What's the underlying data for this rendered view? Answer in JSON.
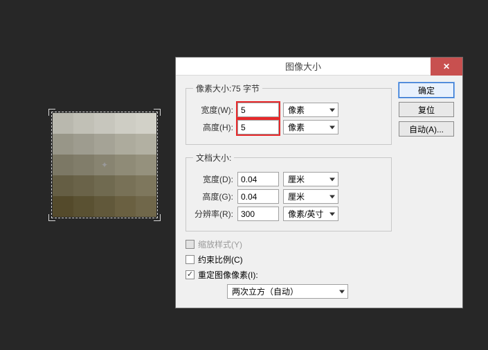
{
  "dialog": {
    "title": "图像大小",
    "close_icon": "✕",
    "pixel_size": {
      "legend": "像素大小:75 字节",
      "width_label": "宽度(W):",
      "width_value": "5",
      "height_label": "高度(H):",
      "height_value": "5",
      "unit": "像素"
    },
    "doc_size": {
      "legend": "文档大小:",
      "width_label": "宽度(D):",
      "width_value": "0.04",
      "height_label": "高度(G):",
      "height_value": "0.04",
      "dim_unit": "厘米",
      "res_label": "分辨率(R):",
      "res_value": "300",
      "res_unit": "像素/英寸"
    },
    "options": {
      "scale_styles": "缩放样式(Y)",
      "constrain": "约束比例(C)",
      "resample": "重定图像像素(I):",
      "resample_method": "两次立方（自动）"
    },
    "buttons": {
      "ok": "确定",
      "cancel": "复位",
      "auto": "自动(A)..."
    }
  },
  "grid_colors": [
    [
      "#b9b8ae",
      "#c1c0b6",
      "#c7c6bd",
      "#cecdc4",
      "#d2d1c8"
    ],
    [
      "#989688",
      "#9e9c8f",
      "#a5a396",
      "#adab9d",
      "#b2b0a2"
    ],
    [
      "#7c7865",
      "#817d6a",
      "#888471",
      "#8f8b77",
      "#95917d"
    ],
    [
      "#655e44",
      "#6a6349",
      "#706a50",
      "#787157",
      "#7e775d"
    ],
    [
      "#544a2b",
      "#5a5132",
      "#61583a",
      "#6a6041",
      "#70674a"
    ]
  ]
}
